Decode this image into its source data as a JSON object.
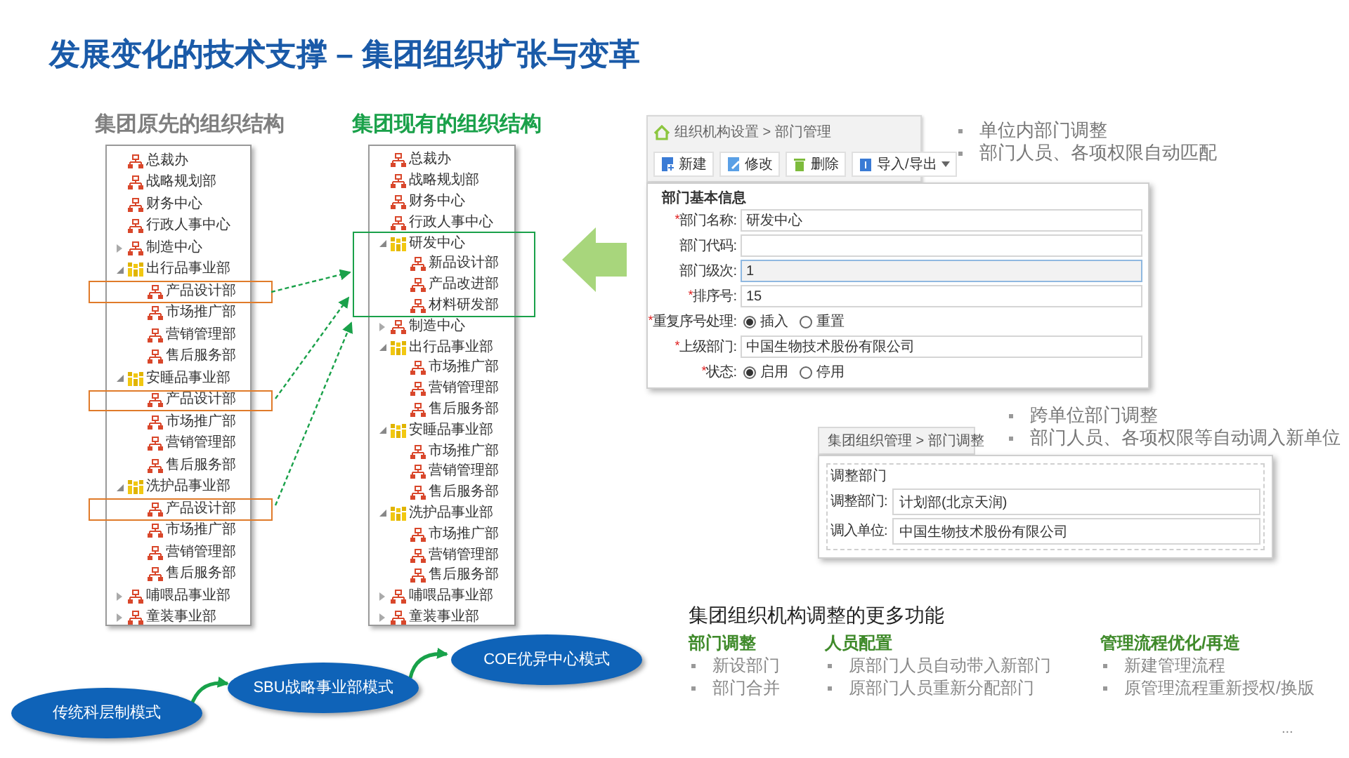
{
  "title": "发展变化的技术支撑 – 集团组织扩张与变革",
  "structures": [
    {
      "title": "集团原先的组织结构",
      "tree": [
        {
          "label": "总裁办",
          "kind": "dept"
        },
        {
          "label": "战略规划部",
          "kind": "dept"
        },
        {
          "label": "财务中心",
          "kind": "dept"
        },
        {
          "label": "行政人事中心",
          "kind": "dept"
        },
        {
          "label": "制造中心",
          "kind": "dept",
          "expanded": false
        },
        {
          "label": "出行品事业部",
          "kind": "unit",
          "expanded": true,
          "children": [
            {
              "label": "产品设计部",
              "kind": "dept",
              "highlighted": true
            },
            {
              "label": "市场推广部",
              "kind": "dept"
            },
            {
              "label": "营销管理部",
              "kind": "dept"
            },
            {
              "label": "售后服务部",
              "kind": "dept"
            }
          ]
        },
        {
          "label": "安睡品事业部",
          "kind": "unit",
          "expanded": true,
          "children": [
            {
              "label": "产品设计部",
              "kind": "dept",
              "highlighted": true
            },
            {
              "label": "市场推广部",
              "kind": "dept"
            },
            {
              "label": "营销管理部",
              "kind": "dept"
            },
            {
              "label": "售后服务部",
              "kind": "dept"
            }
          ]
        },
        {
          "label": "洗护品事业部",
          "kind": "unit",
          "expanded": true,
          "children": [
            {
              "label": "产品设计部",
              "kind": "dept",
              "highlighted": true
            },
            {
              "label": "市场推广部",
              "kind": "dept"
            },
            {
              "label": "营销管理部",
              "kind": "dept"
            },
            {
              "label": "售后服务部",
              "kind": "dept"
            }
          ]
        },
        {
          "label": "哺喂品事业部",
          "kind": "dept",
          "expanded": false
        },
        {
          "label": "童装事业部",
          "kind": "dept",
          "expanded": false
        }
      ]
    },
    {
      "title": "集团现有的组织结构",
      "tree": [
        {
          "label": "总裁办",
          "kind": "dept"
        },
        {
          "label": "战略规划部",
          "kind": "dept"
        },
        {
          "label": "财务中心",
          "kind": "dept"
        },
        {
          "label": "行政人事中心",
          "kind": "dept"
        },
        {
          "label": "研发中心",
          "kind": "unit",
          "expanded": true,
          "highlighted": true,
          "children": [
            {
              "label": "新品设计部",
              "kind": "dept"
            },
            {
              "label": "产品改进部",
              "kind": "dept"
            },
            {
              "label": "材料研发部",
              "kind": "dept"
            }
          ]
        },
        {
          "label": "制造中心",
          "kind": "dept",
          "expanded": false
        },
        {
          "label": "出行品事业部",
          "kind": "unit",
          "expanded": true,
          "children": [
            {
              "label": "市场推广部",
              "kind": "dept"
            },
            {
              "label": "营销管理部",
              "kind": "dept"
            },
            {
              "label": "售后服务部",
              "kind": "dept"
            }
          ]
        },
        {
          "label": "安睡品事业部",
          "kind": "unit",
          "expanded": true,
          "children": [
            {
              "label": "市场推广部",
              "kind": "dept"
            },
            {
              "label": "营销管理部",
              "kind": "dept"
            },
            {
              "label": "售后服务部",
              "kind": "dept"
            }
          ]
        },
        {
          "label": "洗护品事业部",
          "kind": "unit",
          "expanded": true,
          "children": [
            {
              "label": "市场推广部",
              "kind": "dept"
            },
            {
              "label": "营销管理部",
              "kind": "dept"
            },
            {
              "label": "售后服务部",
              "kind": "dept"
            }
          ]
        },
        {
          "label": "哺喂品事业部",
          "kind": "dept",
          "expanded": false
        },
        {
          "label": "童装事业部",
          "kind": "dept",
          "expanded": false
        }
      ]
    }
  ],
  "dept_form": {
    "breadcrumb": "组织机构设置 > 部门管理",
    "toolbar": [
      {
        "label": "新建",
        "kind": "new"
      },
      {
        "label": "修改",
        "kind": "edit"
      },
      {
        "label": "删除",
        "kind": "delete"
      },
      {
        "label": "导入/导出",
        "kind": "import_export"
      }
    ],
    "section": "部门基本信息",
    "fields": [
      {
        "kind": "text",
        "required_mark": "*",
        "label": "部门名称:",
        "value": "研发中心"
      },
      {
        "kind": "text",
        "label": "部门代码:"
      },
      {
        "kind": "text",
        "label": "部门级次:",
        "value": "1",
        "disabled": true
      },
      {
        "kind": "text",
        "required_mark": "*",
        "label": "排序号:",
        "value": "15"
      },
      {
        "kind": "radio",
        "required_mark": "*",
        "label": "重复序号处理:",
        "options": [
          {
            "label": "插入",
            "selected": true
          },
          {
            "label": "重置",
            "selected": false
          }
        ]
      },
      {
        "kind": "text",
        "required_mark": "*",
        "label": "上级部门:",
        "value": "中国生物技术股份有限公司"
      },
      {
        "kind": "radio",
        "required_mark": "*",
        "label": "状态:",
        "options": [
          {
            "label": "启用",
            "selected": true
          },
          {
            "label": "停用",
            "selected": false
          }
        ]
      }
    ]
  },
  "dept_notes": [
    "单位内部门调整",
    "部门人员、各项权限自动匹配"
  ],
  "transfer_form": {
    "breadcrumb": "集团组织管理 > 部门调整",
    "section": "调整部门",
    "fields": [
      {
        "label": "调整部门:",
        "value": "计划部(北京天润)"
      },
      {
        "label": "调入单位:",
        "value": "中国生物技术股份有限公司"
      }
    ]
  },
  "transfer_notes": [
    "跨单位部门调整",
    "部门人员、各项权限等自动调入新单位"
  ],
  "more_features": {
    "title": "集团组织机构调整的更多功能",
    "groups": [
      {
        "heading": "部门调整",
        "items": [
          "新设部门",
          "部门合并"
        ]
      },
      {
        "heading": "人员配置",
        "items": [
          "原部门人员自动带入新部门",
          "原部门人员重新分配部门"
        ]
      },
      {
        "heading": "管理流程优化/再造",
        "items": [
          "新建管理流程",
          "原管理流程重新授权/换版"
        ]
      }
    ],
    "more": "..."
  },
  "models": [
    {
      "label": "传统科层制模式"
    },
    {
      "label": "SBU战略事业部模式"
    },
    {
      "label": "COE优异中心模式"
    }
  ]
}
